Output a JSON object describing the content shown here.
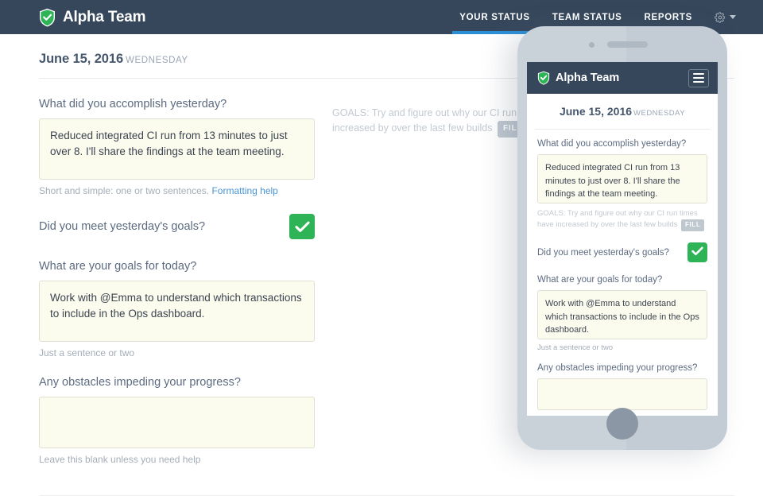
{
  "header": {
    "brand": "Alpha Team",
    "logo_icon": "shield-check-icon",
    "background_color": "#36475c",
    "accent_color": "#2b8fd8",
    "nav": [
      {
        "label": "YOUR STATUS",
        "active": true
      },
      {
        "label": "TEAM STATUS",
        "active": false
      },
      {
        "label": "REPORTS",
        "active": false
      }
    ],
    "settings_icon": "gear-icon",
    "settings_caret_icon": "chevron-down-icon"
  },
  "page": {
    "date": "June 15, 2016",
    "weekday": "WEDNESDAY"
  },
  "form": {
    "q1": {
      "label": "What did you accomplish yesterday?",
      "value": "Reduced integrated CI run from 13 minutes to just over 8. I'll share the findings at the team meeting.",
      "placeholder": "",
      "helper": "Short and simple: one or two sentences.",
      "helper_link": "Formatting help"
    },
    "goals_note": {
      "prefix": "GOALS:",
      "text": "Try and figure out why our CI run times have increased by over the last few builds",
      "badge": "FILL"
    },
    "q2": {
      "label": "Did you meet yesterday's goals?",
      "checked": true,
      "check_icon": "checkmark-icon",
      "check_color": "#2eb357"
    },
    "q3": {
      "label": "What are your goals for today?",
      "value": "Work with @Emma to understand which transactions to include in the Ops dashboard.",
      "placeholder": "",
      "helper": "Just a sentence or two"
    },
    "q4": {
      "label": "Any obstacles impeding your progress?",
      "value": "",
      "placeholder": "",
      "helper": "Leave this blank unless you need help"
    }
  },
  "phone": {
    "camera_icon": "camera-dot-icon",
    "speaker_icon": "speaker-grille-icon",
    "home_button_icon": "home-button-icon",
    "header": {
      "brand": "Alpha Team",
      "logo_icon": "shield-check-icon",
      "menu_icon": "hamburger-menu-icon"
    },
    "date": "June 15, 2016",
    "weekday": "WEDNESDAY",
    "q1": {
      "label": "What did you accomplish yesterday?",
      "value": "Reduced integrated CI run from 13 minutes to just over 8. I'll share the findings at the team meeting."
    },
    "goals_note": {
      "prefix": "GOALS:",
      "text": "Try and figure out why our CI run times have increased by over the last few builds",
      "badge": "FILL"
    },
    "q2": {
      "label": "Did you meet yesterday's goals?",
      "check_icon": "checkmark-icon"
    },
    "q3": {
      "label": "What are your goals for today?",
      "value": "Work with @Emma to understand which transactions to include in the Ops dashboard.",
      "helper": "Just a sentence or two"
    },
    "q4": {
      "label": "Any obstacles impeding your progress?",
      "value": ""
    }
  }
}
